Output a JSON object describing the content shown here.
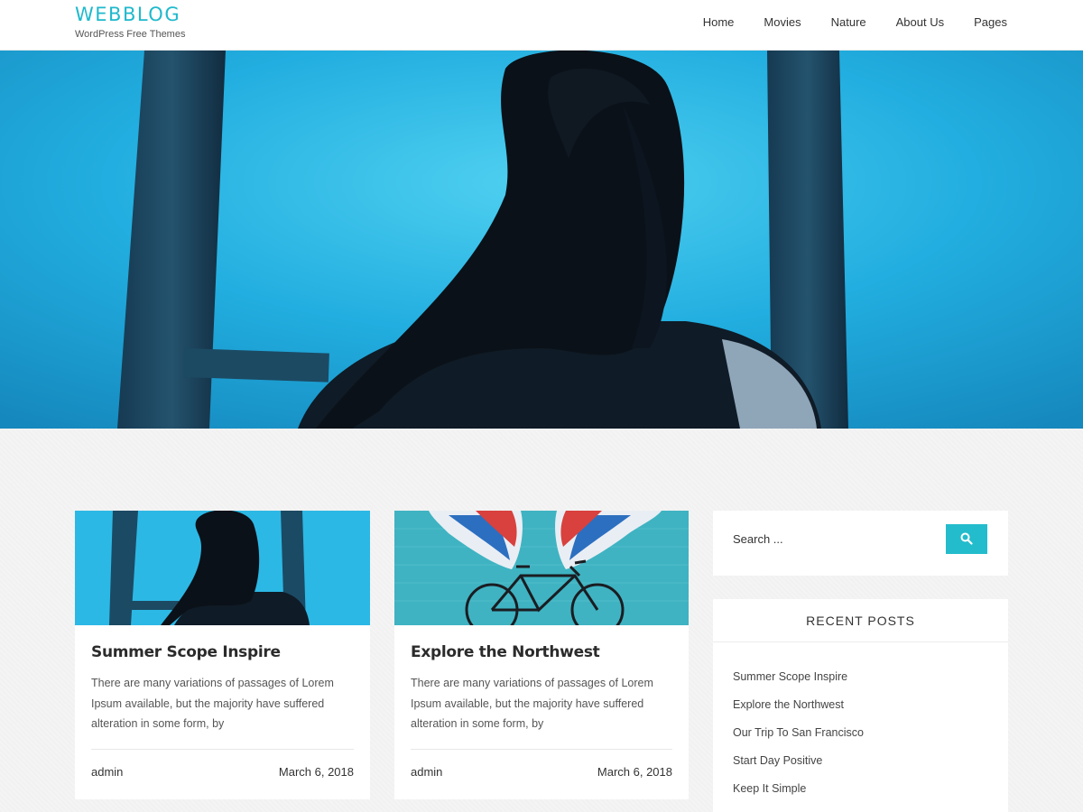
{
  "header": {
    "site_title": "WEBBLOG",
    "site_description": "WordPress Free Themes",
    "nav": [
      "Home",
      "Movies",
      "Nature",
      "About Us",
      "Pages"
    ]
  },
  "posts": [
    {
      "title": "Summer Scope Inspire",
      "excerpt": "There are many variations of passages of Lorem Ipsum available, but the majority have suffered alteration in some form, by",
      "author": "admin",
      "date": "March 6, 2018"
    },
    {
      "title": "Explore the Northwest",
      "excerpt": "There are many variations of passages of Lorem Ipsum available, but the majority have suffered alteration in some form, by",
      "author": "admin",
      "date": "March 6, 2018"
    }
  ],
  "sidebar": {
    "search_placeholder": "Search ...",
    "recent_title": "RECENT POSTS",
    "recent_posts": [
      "Summer Scope Inspire",
      "Explore the Northwest",
      "Our Trip To San Francisco",
      "Start Day Positive",
      "Keep It Simple"
    ]
  },
  "colors": {
    "accent": "#1fb9cc",
    "hero_blue": "#1fa8d8",
    "page_background": "#f4f4f4"
  }
}
